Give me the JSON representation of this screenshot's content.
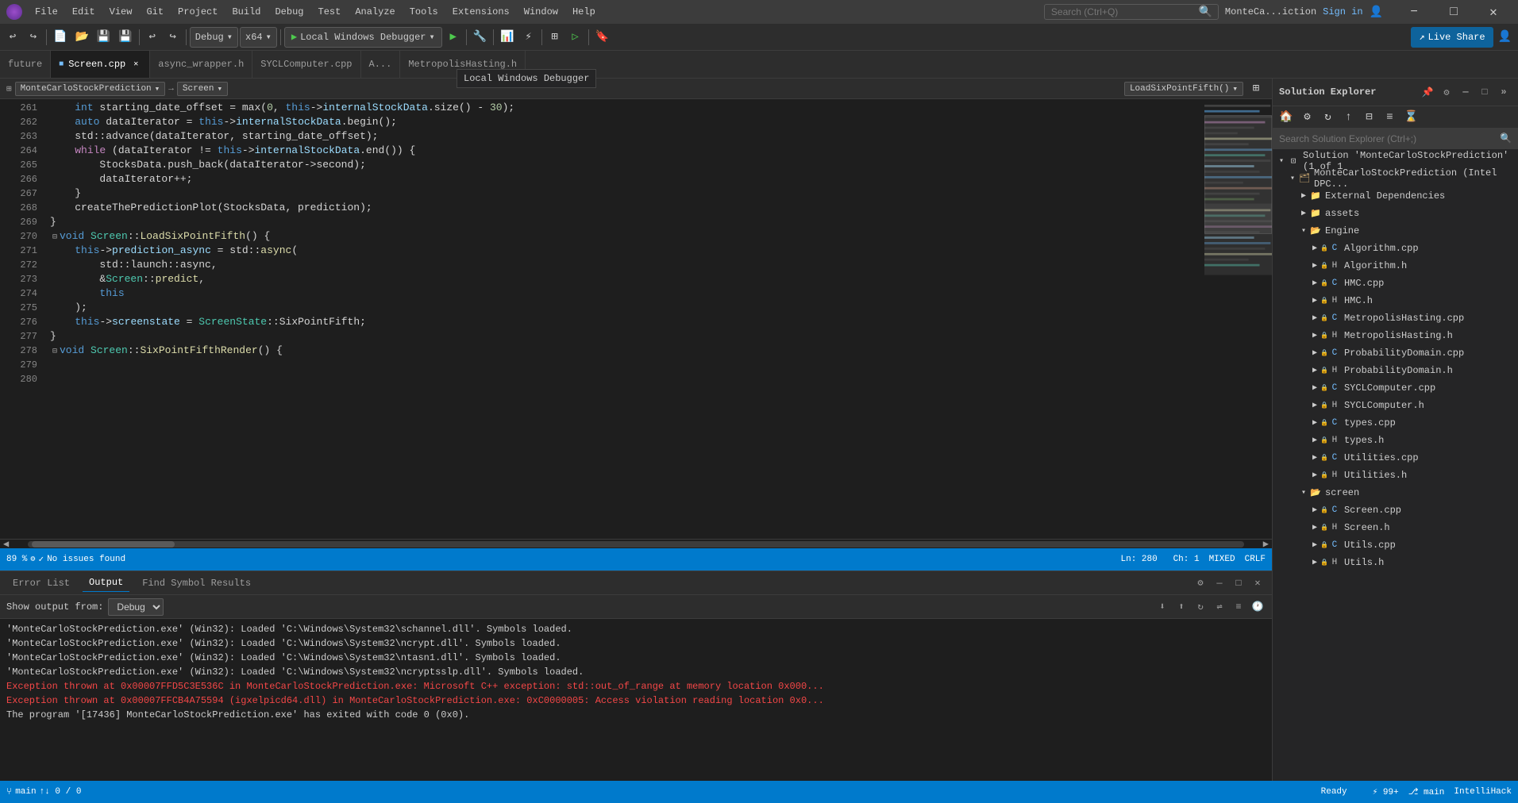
{
  "titlebar": {
    "menus": [
      "File",
      "Edit",
      "View",
      "Git",
      "Project",
      "Build",
      "Debug",
      "Test",
      "Analyze",
      "Tools",
      "Extensions",
      "Window",
      "Help"
    ],
    "search_placeholder": "Search (Ctrl+Q)",
    "project_name": "MonteCa...iction",
    "sign_in": "Sign in",
    "minimize": "−",
    "maximize": "□",
    "close": "✕"
  },
  "toolbar": {
    "back": "←",
    "forward": "→",
    "dropdown_arrow": "▾",
    "debug_mode": "Debug",
    "platform": "x64",
    "run_label": "Local Windows Debugger",
    "live_share": "Live Share"
  },
  "tabs": [
    {
      "name": "future",
      "active": false,
      "modified": false
    },
    {
      "name": "Screen.cpp",
      "active": true,
      "modified": true
    },
    {
      "name": "async_wrapper.h",
      "active": false,
      "modified": false
    },
    {
      "name": "SYCLComputer.cpp",
      "active": false,
      "modified": false
    },
    {
      "name": "A...",
      "active": false,
      "modified": false
    },
    {
      "name": "MetropolisHasting.h",
      "active": false,
      "modified": false
    }
  ],
  "editor": {
    "file_class": "MonteCarloStockPrediction",
    "nav_left": "Screen",
    "nav_right": "LoadSixPointFifth()",
    "lines": [
      {
        "num": "",
        "text": "    int starting_date_offset = max(0, this->internalStockData.size() - 30);"
      },
      {
        "num": "",
        "text": "    auto dataIterator = this->internalStockData.begin();"
      },
      {
        "num": "",
        "text": "    std::advance(dataIterator, starting_date_offset);"
      },
      {
        "num": "",
        "text": "    while (dataIterator != this->internalStockData.end()) {"
      },
      {
        "num": "",
        "text": "        StocksData.push_back(dataIterator->second);"
      },
      {
        "num": "",
        "text": "        dataIterator++;"
      },
      {
        "num": "",
        "text": "    }"
      },
      {
        "num": "",
        "text": "    createThePredictionPlot(StocksData, prediction);"
      },
      {
        "num": "",
        "text": "}"
      },
      {
        "num": "",
        "text": ""
      },
      {
        "num": "",
        "text": "void Screen::LoadSixPointFifth() {"
      },
      {
        "num": "",
        "text": "    this->prediction_async = std::async("
      },
      {
        "num": "",
        "text": "        std::launch::async,"
      },
      {
        "num": "",
        "text": "        &Screen::predict,"
      },
      {
        "num": "",
        "text": "        this"
      },
      {
        "num": "",
        "text": "    );"
      },
      {
        "num": "",
        "text": "    this->screenstate = ScreenState::SixPointFifth;"
      },
      {
        "num": "",
        "text": "}"
      },
      {
        "num": "",
        "text": ""
      },
      {
        "num": "",
        "text": "void Screen::SixPointFifthRender() {"
      }
    ],
    "zoom": "89 %",
    "status": "No issues found",
    "line": "Ln: 280",
    "col": "Ch: 1",
    "encoding": "MIXED",
    "line_ending": "CRLF"
  },
  "output": {
    "tabs": [
      "Error List",
      "Output",
      "Find Symbol Results"
    ],
    "active_tab": "Output",
    "show_output_from": "Show output from:",
    "source": "Debug",
    "lines": [
      "'MonteCarloStockPrediction.exe' (Win32): Loaded 'C:\\Windows\\System32\\schannel.dll'. Symbols loaded.",
      "'MonteCarloStockPrediction.exe' (Win32): Loaded 'C:\\Windows\\System32\\ncrypt.dll'. Symbols loaded.",
      "'MonteCarloStockPrediction.exe' (Win32): Loaded 'C:\\Windows\\System32\\ntasn1.dll'. Symbols loaded.",
      "'MonteCarloStockPrediction.exe' (Win32): Loaded 'C:\\Windows\\System32\\ncryptsslp.dll'. Symbols loaded.",
      "Exception thrown at 0x00007FFD5C3E536C in MonteCarloStockPrediction.exe: Microsoft C++ exception: std::out_of_range at memory location 0x000...",
      "Exception thrown at 0x00007FFCB4A75594 (igxelpicd64.dll) in MonteCarloStockPrediction.exe: 0xC0000005: Access violation reading location 0x0...",
      "",
      "The program '[17436] MonteCarloStockPrediction.exe' has exited with code 0 (0x0)."
    ]
  },
  "solution_explorer": {
    "title": "Solution Explorer",
    "search_placeholder": "Search Solution Explorer (Ctrl+;)",
    "tree": [
      {
        "indent": 0,
        "type": "solution",
        "label": "Solution 'MonteCarloStockPrediction' (1 of 1",
        "expanded": true
      },
      {
        "indent": 1,
        "type": "project",
        "label": "MonteCarloStockPrediction (Intel DPC...",
        "expanded": true
      },
      {
        "indent": 2,
        "type": "folder",
        "label": "External Dependencies",
        "expanded": false
      },
      {
        "indent": 2,
        "type": "folder",
        "label": "assets",
        "expanded": false
      },
      {
        "indent": 2,
        "type": "folder-open",
        "label": "Engine",
        "expanded": true
      },
      {
        "indent": 3,
        "type": "cpp",
        "label": "Algorithm.cpp",
        "locked": true
      },
      {
        "indent": 3,
        "type": "h",
        "label": "Algorithm.h",
        "locked": true
      },
      {
        "indent": 3,
        "type": "cpp",
        "label": "HMC.cpp",
        "locked": true
      },
      {
        "indent": 3,
        "type": "h",
        "label": "HMC.h",
        "locked": true
      },
      {
        "indent": 3,
        "type": "cpp",
        "label": "MetropolisHasting.cpp",
        "locked": true
      },
      {
        "indent": 3,
        "type": "h",
        "label": "MetropolisHasting.h",
        "locked": true
      },
      {
        "indent": 3,
        "type": "cpp",
        "label": "ProbabilityDomain.cpp",
        "locked": true
      },
      {
        "indent": 3,
        "type": "h",
        "label": "ProbabilityDomain.h",
        "locked": true
      },
      {
        "indent": 3,
        "type": "cpp",
        "label": "SYCLComputer.cpp",
        "locked": true
      },
      {
        "indent": 3,
        "type": "h",
        "label": "SYCLComputer.h",
        "locked": true
      },
      {
        "indent": 3,
        "type": "cpp",
        "label": "types.cpp",
        "locked": true
      },
      {
        "indent": 3,
        "type": "h",
        "label": "types.h",
        "locked": true
      },
      {
        "indent": 3,
        "type": "cpp",
        "label": "Utilities.cpp",
        "locked": true
      },
      {
        "indent": 3,
        "type": "h",
        "label": "Utilities.h",
        "locked": true
      },
      {
        "indent": 2,
        "type": "folder-open",
        "label": "screen",
        "expanded": true
      },
      {
        "indent": 3,
        "type": "cpp",
        "label": "Screen.cpp",
        "locked": true
      },
      {
        "indent": 3,
        "type": "h",
        "label": "Screen.h",
        "locked": true
      },
      {
        "indent": 3,
        "type": "cpp",
        "label": "Utils.cpp",
        "locked": true
      },
      {
        "indent": 3,
        "type": "h",
        "label": "Utils.h",
        "locked": true
      }
    ]
  },
  "statusbar": {
    "git": "main",
    "errors": "0 / 0",
    "extensions": "99+",
    "branch": "main",
    "theme": "IntelliHack",
    "ready": "Ready"
  },
  "tooltip": {
    "text": "Local Windows Debugger"
  }
}
